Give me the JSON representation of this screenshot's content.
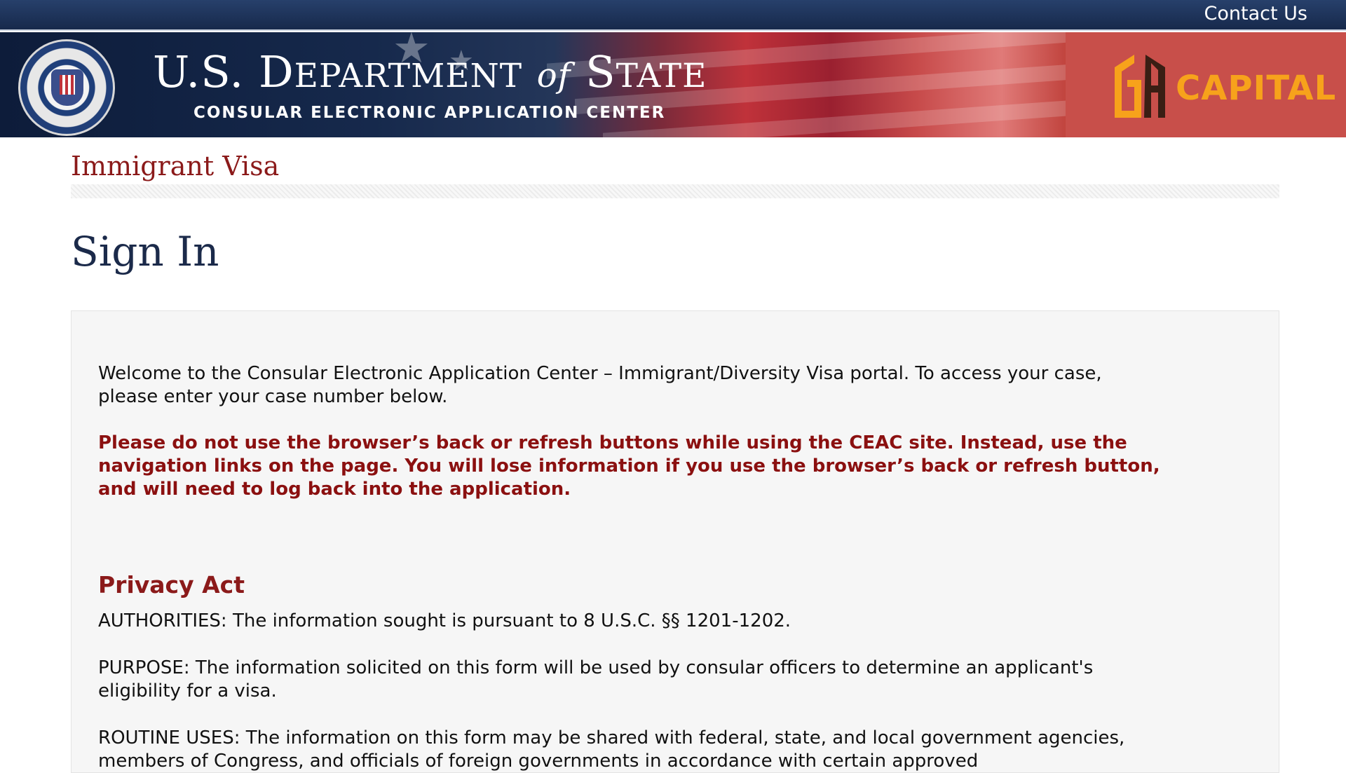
{
  "header": {
    "contact_label": "Contact Us",
    "dept_title_p1": "U.S. D",
    "dept_title_p2": "EPARTMENT",
    "dept_title_of": "of",
    "dept_title_p3": "S",
    "dept_title_p4": "TATE",
    "dept_subtitle": "CONSULAR ELECTRONIC APPLICATION CENTER",
    "partner_name": "CAPITAL"
  },
  "page": {
    "section_title": "Immigrant Visa",
    "heading": "Sign In"
  },
  "content": {
    "welcome": "Welcome to the Consular Electronic Application Center – Immigrant/Diversity Visa portal. To access your case, please enter your case number below.",
    "warning": "Please do not use the browser’s back or refresh buttons while using the CEAC site. Instead, use the navigation links on the page. You will lose information if you use the browser’s back or refresh button, and will need to log back into the application.",
    "privacy_heading": "Privacy Act",
    "authorities": "AUTHORITIES: The information sought is pursuant to 8 U.S.C. §§ 1201-1202.",
    "purpose": "PURPOSE: The information solicited on this form will be used by consular officers to determine an applicant's eligibility for a visa.",
    "routine_uses": "ROUTINE USES: The information on this form may be shared with federal, state, and local government agencies, members of Congress, and officials of foreign governments in accordance with certain approved"
  },
  "colors": {
    "section_red": "#8b1a1a",
    "heading_navy": "#1b2a4a",
    "partner_orange": "#f7a21b",
    "partner_bg": "#c84f4a"
  }
}
